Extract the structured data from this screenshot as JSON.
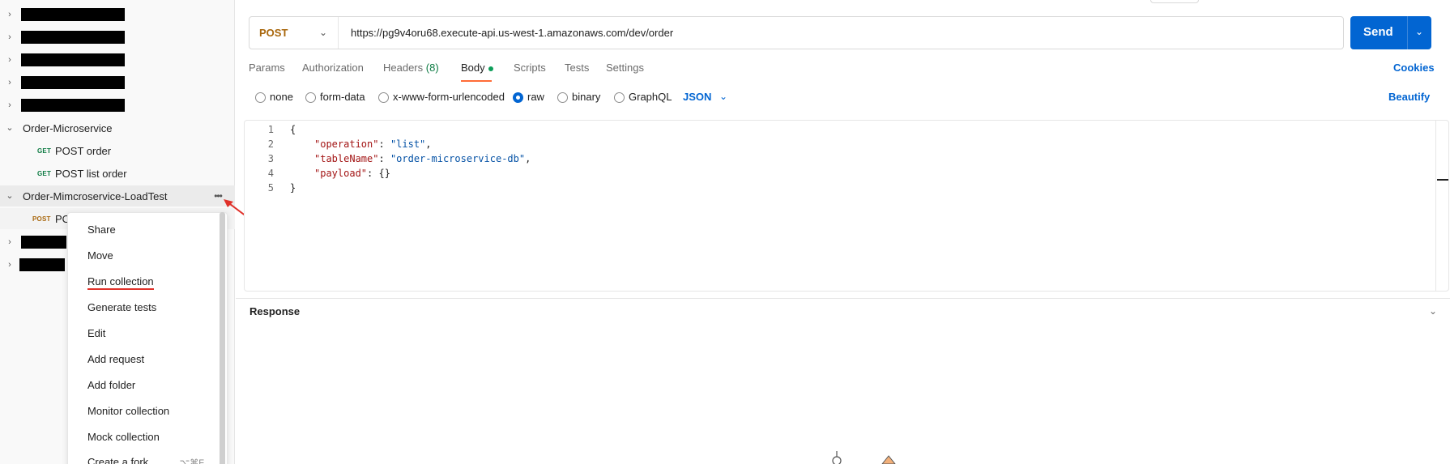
{
  "sidebar": {
    "redacted_rows": 5,
    "folders": [
      {
        "label": "Order-Microservice",
        "requests": [
          {
            "method": "GET",
            "label": "POST order"
          },
          {
            "method": "GET",
            "label": "POST list order"
          }
        ]
      },
      {
        "label": "Order-Mimcroservice-LoadTest",
        "requests": [
          {
            "method": "POST",
            "label": "PO"
          }
        ]
      }
    ]
  },
  "context_menu": {
    "items": [
      {
        "label": "Share"
      },
      {
        "label": "Move"
      },
      {
        "label": "Run collection"
      },
      {
        "label": "Generate tests"
      },
      {
        "label": "Edit"
      },
      {
        "label": "Add request"
      },
      {
        "label": "Add folder"
      },
      {
        "label": "Monitor collection"
      },
      {
        "label": "Mock collection"
      },
      {
        "label": "Create a fork",
        "shortcut": "⌥⌘F"
      }
    ]
  },
  "request": {
    "method": "POST",
    "url": "https://pg9v4oru68.execute-api.us-west-1.amazonaws.com/dev/order",
    "send_label": "Send"
  },
  "tabs": {
    "params": "Params",
    "authorization": "Authorization",
    "headers": "Headers",
    "headers_count": "(8)",
    "body": "Body",
    "scripts": "Scripts",
    "tests": "Tests",
    "settings": "Settings",
    "cookies": "Cookies"
  },
  "body_types": {
    "none": "none",
    "form_data": "form-data",
    "urlencoded": "x-www-form-urlencoded",
    "raw": "raw",
    "binary": "binary",
    "graphql": "GraphQL",
    "format": "JSON",
    "beautify": "Beautify"
  },
  "editor": {
    "line_numbers": [
      "1",
      "2",
      "3",
      "4",
      "5"
    ],
    "lines": {
      "l1": "{",
      "l2_key": "\"operation\"",
      "l2_val": "\"list\"",
      "l3_key": "\"tableName\"",
      "l3_val": "\"order-microservice-db\"",
      "l4_key": "\"payload\"",
      "l4_val": "{}",
      "l5": "}"
    }
  },
  "response": {
    "label": "Response"
  },
  "colors": {
    "accent_blue": "#0265d2",
    "post_method": "#a8660b",
    "get_method": "#0c7a42",
    "active_tab_underline": "#ff6c37",
    "annotation_red": "#e0312a"
  }
}
